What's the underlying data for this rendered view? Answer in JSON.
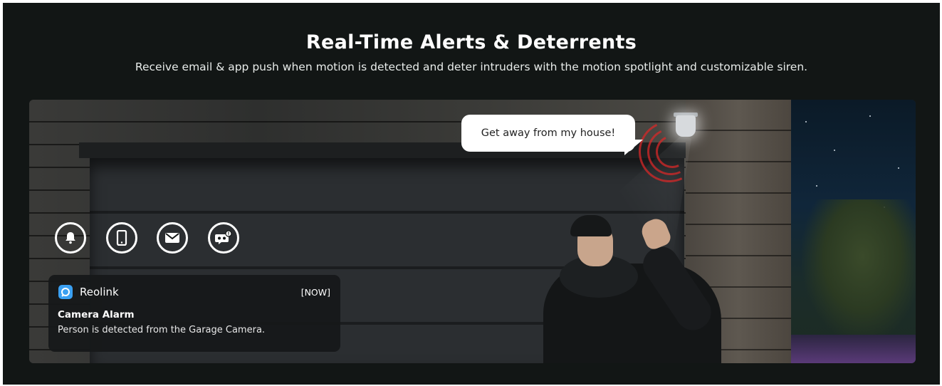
{
  "header": {
    "title": "Real-Time Alerts & Deterrents",
    "subtitle": "Receive email & app push when motion is detected and deter intruders with the motion spotlight and customizable siren."
  },
  "scene": {
    "speech_bubble": "Get away from my house!"
  },
  "alert_icons": [
    "bell-icon",
    "phone-icon",
    "email-icon",
    "voice-message-icon"
  ],
  "notification": {
    "app_name": "Reolink",
    "time": "[NOW]",
    "title": "Camera Alarm",
    "body": "Person is detected from the Garage Camera."
  },
  "colors": {
    "background": "#121615",
    "app_logo": "#3aa0f2",
    "siren": "#d62828"
  }
}
